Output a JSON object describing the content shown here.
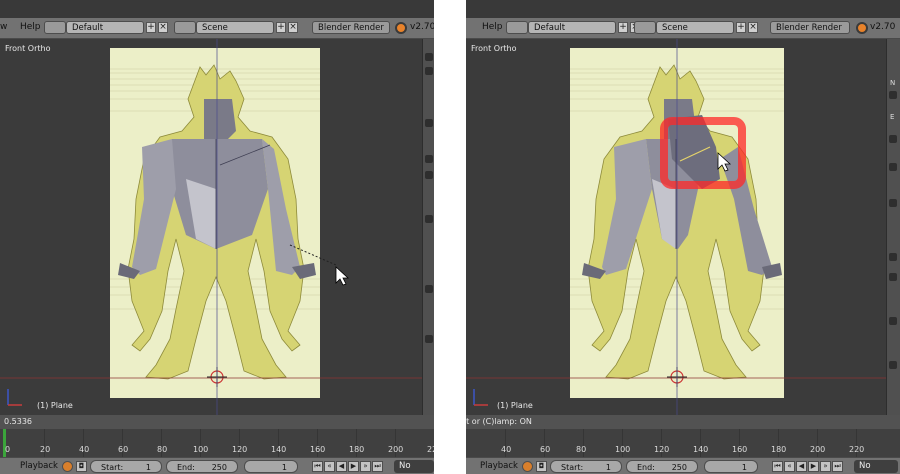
{
  "left": {
    "header": {
      "menu_partial": "w",
      "help": "Help",
      "layout": "Default",
      "scene": "Scene",
      "engine": "Blender Render",
      "version": "v2.70"
    },
    "viewport": {
      "view_label": "Front Ortho",
      "object_label": "(1) Plane"
    },
    "timeline": {
      "status": "0.5336"
    },
    "footer": {
      "playback": "Playback",
      "start_label": "Start:",
      "start_value": "1",
      "end_label": "End:",
      "end_value": "250",
      "current_frame": "1",
      "sync": "No Sync"
    }
  },
  "right": {
    "header": {
      "help": "Help",
      "layout": "Default",
      "scene": "Scene",
      "engine": "Blender Render",
      "version": "v2.70"
    },
    "viewport": {
      "view_label": "Front Ortho",
      "object_label": "(1) Plane"
    },
    "timeline": {
      "status": "alt or (C)lamp: ON"
    },
    "footer": {
      "playback": "Playback",
      "start_label": "Start:",
      "start_value": "1",
      "end_label": "End:",
      "end_value": "250",
      "current_frame": "1",
      "sync": "No Sync"
    },
    "sidebar_letters": [
      "N",
      "E"
    ]
  },
  "timeline_ticks": [
    "0",
    "20",
    "40",
    "60",
    "80",
    "100",
    "120",
    "140",
    "160",
    "180",
    "200",
    "220"
  ],
  "colors": {
    "header": "#727272",
    "viewport": "#3b3b3b",
    "reference": "#ecefc8",
    "mesh": "#8a8a98",
    "highlight": "#ff2828",
    "playhead": "#3ba53b"
  }
}
